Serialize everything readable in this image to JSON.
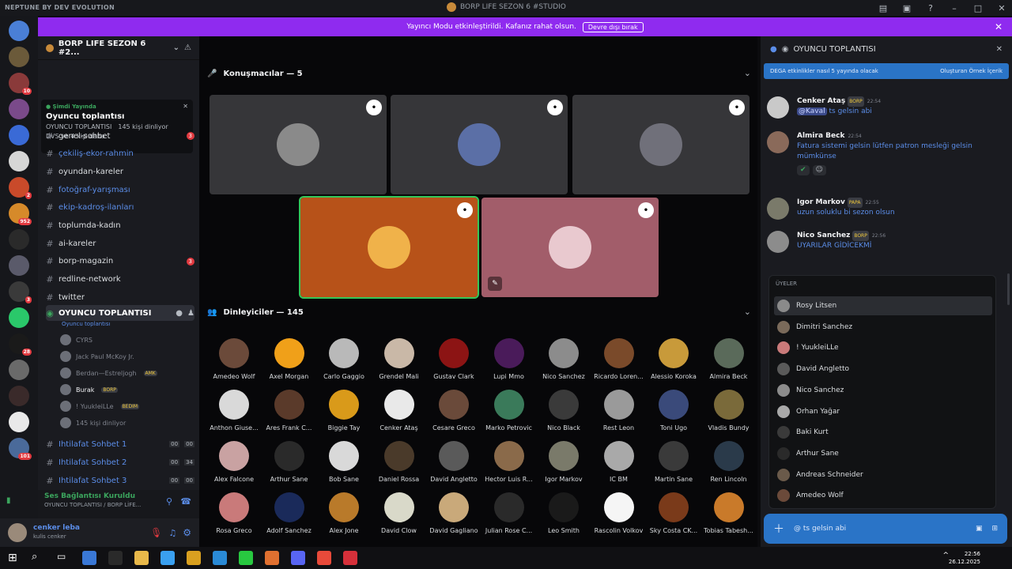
{
  "window": {
    "left_title": "NEPTUNE BY DEV EVOLUTION",
    "title": "BORP LIFE SEZON 6 #STUDIO",
    "controls": [
      "–",
      "□",
      "✕"
    ]
  },
  "banner": {
    "text": "Yayıncı Modu etkinleştirildi. Kafanız rahat olsun.",
    "button": "Devre dışı bırak"
  },
  "server": {
    "name": "BORP LIFE SEZON 6 #2...",
    "live_label": "Şimdi Yayında",
    "live_title": "Oyuncu toplantısı",
    "live_channel": "OYUNCU TOPLANTISI",
    "live_listeners": "145 kişi dinliyor",
    "live_sub": "DVS ve 4 kişi daha"
  },
  "channels": [
    {
      "icon": "hash",
      "label": "genel-sohbet",
      "alert": "3",
      "link": false
    },
    {
      "icon": "hash",
      "label": "çekiliş-ekor-rahmin",
      "alert": "",
      "link": true
    },
    {
      "icon": "hash",
      "label": "oyundan-kareler",
      "alert": "",
      "link": false
    },
    {
      "icon": "hash",
      "label": "fotoğraf-yarışması",
      "alert": "",
      "link": true
    },
    {
      "icon": "hash",
      "label": "ekip-kadroş-ilanları",
      "alert": "",
      "link": true
    },
    {
      "icon": "hash",
      "label": "toplumda-kadın",
      "alert": "",
      "link": false
    },
    {
      "icon": "hash",
      "label": "ai-kareler",
      "alert": "",
      "link": false
    },
    {
      "icon": "hash",
      "label": "borp-magazin",
      "alert": "3",
      "link": false
    },
    {
      "icon": "hash",
      "label": "redline-network",
      "alert": "",
      "link": false
    },
    {
      "icon": "hash",
      "label": "twitter",
      "alert": "",
      "link": false
    }
  ],
  "voice_channel": {
    "label": "OYUNCU TOPLANTISI",
    "sub": "Oyuncu toplantısı",
    "users": [
      {
        "name": "CYRS",
        "tag": ""
      },
      {
        "name": "Jack Paul McKoy Jr.",
        "tag": ""
      },
      {
        "name": "Berdan—Estreljogh",
        "tag": "AMK"
      },
      {
        "name": "Burak",
        "tag": "BORP"
      },
      {
        "name": "! YuukleiLLe",
        "tag": "BEDIM"
      },
      {
        "name": "145 kişi dinliyor",
        "tag": ""
      }
    ]
  },
  "extra_channels": [
    {
      "label": "Ihtilafat Sohbet 1",
      "a": "00",
      "b": "00"
    },
    {
      "label": "Ihtilafat Sohbet 2",
      "a": "00",
      "b": "34"
    },
    {
      "label": "Ihtilafat Sohbet 3",
      "a": "00",
      "b": "00"
    }
  ],
  "voice_status": {
    "title": "Ses Bağlantısı Kuruldu",
    "sub": "OYUNCU TOPLANTISI / BORP LİFE..."
  },
  "user": {
    "name": "cenker leba",
    "status": "kulis cenker"
  },
  "speakers_title": "Konuşmacılar — 5",
  "speakers": [
    {
      "bg": "#363639",
      "avatar": "#8a8a8a",
      "border": ""
    },
    {
      "bg": "#363639",
      "avatar": "#5b6fa6",
      "border": ""
    },
    {
      "bg": "#363639",
      "avatar": "#70707a",
      "border": ""
    },
    {
      "bg": "#b75219",
      "avatar": "#f0b24a",
      "border": "#35c65a"
    },
    {
      "bg": "#a25d6a",
      "avatar": "#e9c9cf",
      "border": ""
    }
  ],
  "listeners_title": "Dinleyiciler — 145",
  "listeners": [
    {
      "name": "Amedeo Wolf",
      "color": "#6b4a3a"
    },
    {
      "name": "Axel Morgan",
      "color": "#f0a019"
    },
    {
      "name": "Carlo Gaggio",
      "color": "#b9b9b9"
    },
    {
      "name": "Grendel Mali",
      "color": "#c9b8a7"
    },
    {
      "name": "Gustav Clark",
      "color": "#8c1414"
    },
    {
      "name": "Lupi Mmo",
      "color": "#4a1b5a"
    },
    {
      "name": "Nico Sanchez",
      "color": "#8c8c8c"
    },
    {
      "name": "Ricardo Loren...",
      "color": "#7a4a2a"
    },
    {
      "name": "Alessio Koroka",
      "color": "#c89a3a"
    },
    {
      "name": "Almira Beck",
      "color": "#5a6a5a"
    },
    {
      "name": "Anthon Giuse...",
      "color": "#d9d9d9"
    },
    {
      "name": "Ares Frank C...",
      "color": "#5a3a2a"
    },
    {
      "name": "Biggie Tay",
      "color": "#d99a1a"
    },
    {
      "name": "Cenker Ataş",
      "color": "#e9e9e9"
    },
    {
      "name": "Cesare Greco",
      "color": "#6a4a3a"
    },
    {
      "name": "Marko Petrovic",
      "color": "#3a7a5a"
    },
    {
      "name": "Nico Black",
      "color": "#3a3a3a"
    },
    {
      "name": "Rest Leon",
      "color": "#9a9a9a"
    },
    {
      "name": "Toni Ugo",
      "color": "#3a4a7a"
    },
    {
      "name": "Vladis Bundy",
      "color": "#7a6a3a"
    },
    {
      "name": "Alex Falcone",
      "color": "#c9a2a2"
    },
    {
      "name": "Arthur Sane",
      "color": "#2a2a2a"
    },
    {
      "name": "Bob Sane",
      "color": "#d9d9d9"
    },
    {
      "name": "Daniel Rossa",
      "color": "#4a3a2a"
    },
    {
      "name": "David Angletto",
      "color": "#5a5a5a"
    },
    {
      "name": "Hector Luis R...",
      "color": "#8a6a4a"
    },
    {
      "name": "Igor Markov",
      "color": "#7a7a6a"
    },
    {
      "name": "IC BM",
      "color": "#a9a9a9"
    },
    {
      "name": "Martin Sane",
      "color": "#3a3a3a"
    },
    {
      "name": "Ren Lincoln",
      "color": "#2a3a4a"
    },
    {
      "name": "Rosa Greco",
      "color": "#c97a7a"
    },
    {
      "name": "Adolf Sanchez",
      "color": "#1a2a5a"
    },
    {
      "name": "Alex Jone",
      "color": "#b97a2a"
    },
    {
      "name": "David Clow",
      "color": "#d9d9c9"
    },
    {
      "name": "David Gagliano",
      "color": "#c9a97a"
    },
    {
      "name": "Julian Rose C...",
      "color": "#2a2a2a"
    },
    {
      "name": "Leo Smith",
      "color": "#1a1a1a"
    },
    {
      "name": "Rascolin Volkov",
      "color": "#f5f5f5"
    },
    {
      "name": "Sky Costa CK...",
      "color": "#7a3a1a"
    },
    {
      "name": "Tobias Tabesh...",
      "color": "#c97a2a"
    }
  ],
  "chat": {
    "channel": "OYUNCU TOPLANTISI",
    "notice": "DEGA etkinlikler nasıl 5 yayında olacak",
    "notice_action": "Oluşturan Örnek İçerik",
    "messages": [
      {
        "name": "Cenker Ataş",
        "tag": "BORP",
        "time": "22:54",
        "mention": "@Kaval",
        "text": "ts gelsin abi",
        "avatar": "#c9c9c9"
      },
      {
        "name": "Almira Beck",
        "tag": "",
        "time": "22:54",
        "mention": "",
        "text": "Fatura sistemi gelsin lütfen patron mesleği gelsin mümkünse",
        "avatar": "#8a6a5a"
      },
      {
        "name": "Igor Markov",
        "tag": "PAPA",
        "time": "22:55",
        "mention": "",
        "text": "uzun soluklu bi sezon olsun",
        "avatar": "#7a7a6a"
      },
      {
        "name": "Nico Sanchez",
        "tag": "BORP",
        "time": "22:56",
        "mention": "",
        "text": "UYARILAR GİDİCEKMİ",
        "avatar": "#8c8c8c"
      }
    ],
    "members_header": "ÜYELER",
    "members": [
      {
        "name": "Rosy Litsen",
        "color": "#8a8a8a"
      },
      {
        "name": "Dimitri Sanchez",
        "color": "#7a6a5a"
      },
      {
        "name": "! YuukleiLLe",
        "color": "#c97a7a"
      },
      {
        "name": "David Angletto",
        "color": "#5a5a5a"
      },
      {
        "name": "Nico Sanchez",
        "color": "#8c8c8c"
      },
      {
        "name": "Orhan Yağar",
        "color": "#a9a9a9"
      },
      {
        "name": "Baki Kurt",
        "color": "#3a3a3a"
      },
      {
        "name": "Arthur Sane",
        "color": "#2a2a2a"
      },
      {
        "name": "Andreas Schneider",
        "color": "#6a5a4a"
      },
      {
        "name": "Amedeo Wolf",
        "color": "#6b4a3a"
      }
    ],
    "input_value": "@ ts gelsin abi"
  },
  "clock": {
    "time": "22:56",
    "date": "26.12.2025"
  },
  "server_icons": [
    {
      "color": "#4a7fd6",
      "badge": ""
    },
    {
      "color": "#6b5a3a",
      "badge": ""
    },
    {
      "color": "#8a3a3a",
      "badge": "10"
    },
    {
      "color": "#7a4a8a",
      "badge": ""
    },
    {
      "color": "#3a6ad6",
      "badge": ""
    },
    {
      "color": "#d6d6d6",
      "badge": ""
    },
    {
      "color": "#c94a2a",
      "badge": "2"
    },
    {
      "color": "#d68a2a",
      "badge": "952"
    },
    {
      "color": "#2a2a2a",
      "badge": ""
    },
    {
      "color": "#5a5a6a",
      "badge": ""
    },
    {
      "color": "#3a3a3a",
      "badge": "3"
    },
    {
      "color": "#2ac86a",
      "badge": ""
    },
    {
      "color": "#1a1a1a",
      "badge": "28"
    },
    {
      "color": "#6a6a6a",
      "badge": ""
    },
    {
      "color": "#3a2a2a",
      "badge": ""
    },
    {
      "color": "#e9e9e9",
      "badge": ""
    },
    {
      "color": "#4a6a9a",
      "badge": "101"
    }
  ],
  "taskbar": [
    {
      "color": "#3a78d6"
    },
    {
      "color": "#2a2a2a"
    },
    {
      "color": "#e8b84a"
    },
    {
      "color": "#3aa0f0"
    },
    {
      "color": "#d9a020"
    },
    {
      "color": "#2a8ad6"
    },
    {
      "color": "#28c840"
    },
    {
      "color": "#e07030"
    },
    {
      "color": "#5865f2"
    },
    {
      "color": "#e84a3a"
    },
    {
      "color": "#d6303a"
    }
  ]
}
